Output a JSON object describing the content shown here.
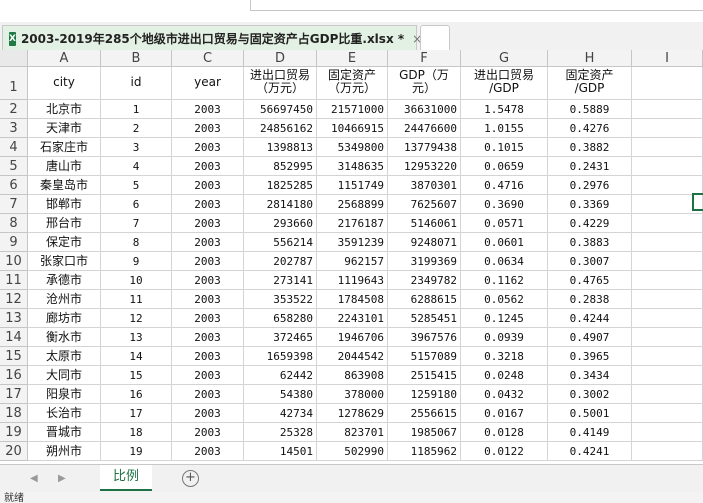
{
  "file_tab": {
    "name": "2003-2019年285个地级市进出口贸易与固定资产占GDP比重.xlsx *",
    "close": "×",
    "icon": "excel-icon"
  },
  "columns": [
    "A",
    "B",
    "C",
    "D",
    "E",
    "F",
    "G",
    "H",
    "I"
  ],
  "header_row": {
    "row_num": "1",
    "A": "city",
    "B": "id",
    "C": "year",
    "D": "进出口贸易\n（万元）",
    "E": "固定资产\n（万元）",
    "F": "GDP（万\n元）",
    "G": "进出口贸易\n/GDP",
    "H": "固定资产\n/GDP",
    "I": ""
  },
  "rows": [
    {
      "n": "2",
      "city": "北京市",
      "id": "1",
      "year": "2003",
      "trade": "56697450",
      "fixed": "21571000",
      "gdp": "36631000",
      "ratio1": "1.5478",
      "ratio2": "0.5889"
    },
    {
      "n": "3",
      "city": "天津市",
      "id": "2",
      "year": "2003",
      "trade": "24856162",
      "fixed": "10466915",
      "gdp": "24476600",
      "ratio1": "1.0155",
      "ratio2": "0.4276"
    },
    {
      "n": "4",
      "city": "石家庄市",
      "id": "3",
      "year": "2003",
      "trade": "1398813",
      "fixed": "5349800",
      "gdp": "13779438",
      "ratio1": "0.1015",
      "ratio2": "0.3882"
    },
    {
      "n": "5",
      "city": "唐山市",
      "id": "4",
      "year": "2003",
      "trade": "852995",
      "fixed": "3148635",
      "gdp": "12953220",
      "ratio1": "0.0659",
      "ratio2": "0.2431"
    },
    {
      "n": "6",
      "city": "秦皇岛市",
      "id": "5",
      "year": "2003",
      "trade": "1825285",
      "fixed": "1151749",
      "gdp": "3870301",
      "ratio1": "0.4716",
      "ratio2": "0.2976"
    },
    {
      "n": "7",
      "city": "邯郸市",
      "id": "6",
      "year": "2003",
      "trade": "2814180",
      "fixed": "2568899",
      "gdp": "7625607",
      "ratio1": "0.3690",
      "ratio2": "0.3369"
    },
    {
      "n": "8",
      "city": "邢台市",
      "id": "7",
      "year": "2003",
      "trade": "293660",
      "fixed": "2176187",
      "gdp": "5146061",
      "ratio1": "0.0571",
      "ratio2": "0.4229"
    },
    {
      "n": "9",
      "city": "保定市",
      "id": "8",
      "year": "2003",
      "trade": "556214",
      "fixed": "3591239",
      "gdp": "9248071",
      "ratio1": "0.0601",
      "ratio2": "0.3883"
    },
    {
      "n": "10",
      "city": "张家口市",
      "id": "9",
      "year": "2003",
      "trade": "202787",
      "fixed": "962157",
      "gdp": "3199369",
      "ratio1": "0.0634",
      "ratio2": "0.3007"
    },
    {
      "n": "11",
      "city": "承德市",
      "id": "10",
      "year": "2003",
      "trade": "273141",
      "fixed": "1119643",
      "gdp": "2349782",
      "ratio1": "0.1162",
      "ratio2": "0.4765"
    },
    {
      "n": "12",
      "city": "沧州市",
      "id": "11",
      "year": "2003",
      "trade": "353522",
      "fixed": "1784508",
      "gdp": "6288615",
      "ratio1": "0.0562",
      "ratio2": "0.2838"
    },
    {
      "n": "13",
      "city": "廊坊市",
      "id": "12",
      "year": "2003",
      "trade": "658280",
      "fixed": "2243101",
      "gdp": "5285451",
      "ratio1": "0.1245",
      "ratio2": "0.4244"
    },
    {
      "n": "14",
      "city": "衡水市",
      "id": "13",
      "year": "2003",
      "trade": "372465",
      "fixed": "1946706",
      "gdp": "3967576",
      "ratio1": "0.0939",
      "ratio2": "0.4907"
    },
    {
      "n": "15",
      "city": "太原市",
      "id": "14",
      "year": "2003",
      "trade": "1659398",
      "fixed": "2044542",
      "gdp": "5157089",
      "ratio1": "0.3218",
      "ratio2": "0.3965"
    },
    {
      "n": "16",
      "city": "大同市",
      "id": "15",
      "year": "2003",
      "trade": "62442",
      "fixed": "863908",
      "gdp": "2515415",
      "ratio1": "0.0248",
      "ratio2": "0.3434"
    },
    {
      "n": "17",
      "city": "阳泉市",
      "id": "16",
      "year": "2003",
      "trade": "54380",
      "fixed": "378000",
      "gdp": "1259180",
      "ratio1": "0.0432",
      "ratio2": "0.3002"
    },
    {
      "n": "18",
      "city": "长治市",
      "id": "17",
      "year": "2003",
      "trade": "42734",
      "fixed": "1278629",
      "gdp": "2556615",
      "ratio1": "0.0167",
      "ratio2": "0.5001"
    },
    {
      "n": "19",
      "city": "晋城市",
      "id": "18",
      "year": "2003",
      "trade": "25328",
      "fixed": "823701",
      "gdp": "1985067",
      "ratio1": "0.0128",
      "ratio2": "0.4149"
    },
    {
      "n": "20",
      "city": "朔州市",
      "id": "19",
      "year": "2003",
      "trade": "14501",
      "fixed": "502990",
      "gdp": "1185962",
      "ratio1": "0.0122",
      "ratio2": "0.4241"
    }
  ],
  "sheet_tab": {
    "label": "比例",
    "add": "+"
  },
  "status": {
    "text": "就绪"
  }
}
